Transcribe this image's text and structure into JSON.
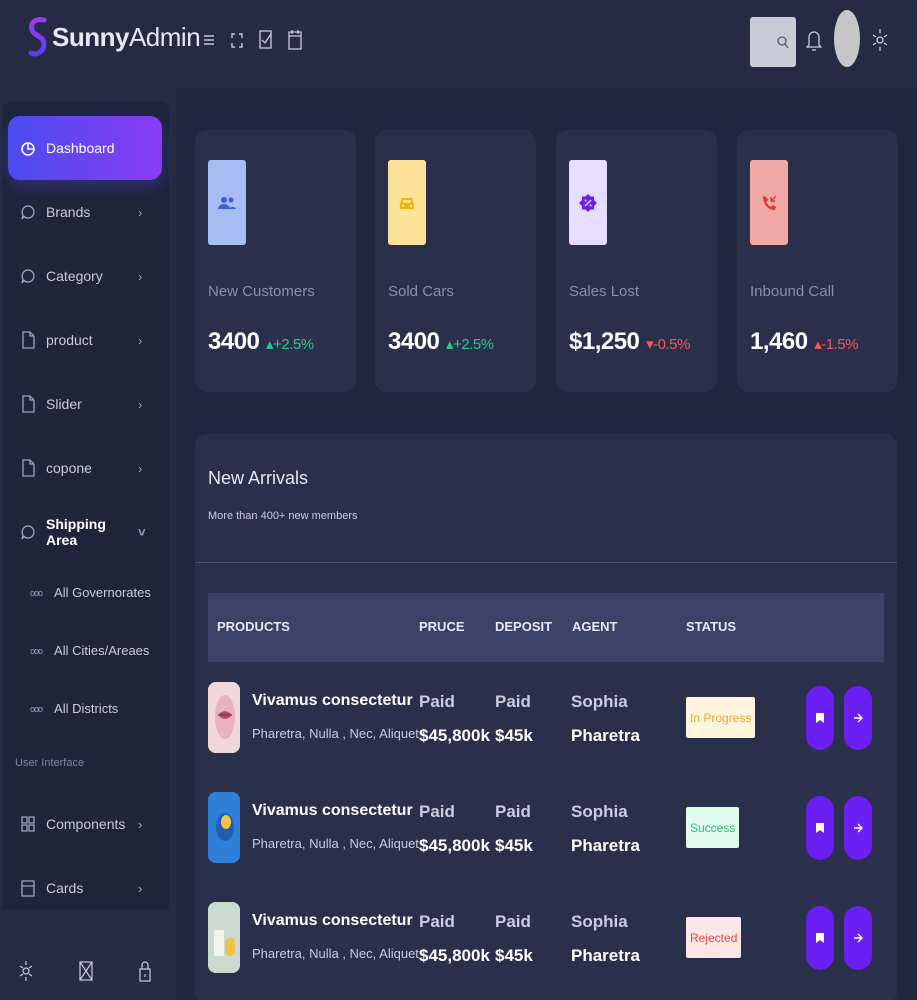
{
  "app": {
    "brand_bold": "Sunny",
    "brand_rest": "Admin"
  },
  "colors": {
    "accent": "#6b1ff2",
    "bg": "#20263d",
    "card": "#2a304c",
    "up": "#2ec98a",
    "down": "#f25a5a"
  },
  "header": {
    "icons": [
      "menu-icon",
      "fullscreen-icon",
      "checklist-icon",
      "calendar-icon",
      "search-icon",
      "bell-icon",
      "avatar",
      "gear-icon"
    ]
  },
  "sidebar": {
    "items": [
      {
        "label": "Dashboard",
        "icon": "pie-chart-icon"
      },
      {
        "label": "Brands",
        "icon": "chat-icon"
      },
      {
        "label": "Category",
        "icon": "chat-icon"
      },
      {
        "label": "product",
        "icon": "file-icon"
      },
      {
        "label": "Slider",
        "icon": "file-icon"
      },
      {
        "label": "copone",
        "icon": "file-icon"
      },
      {
        "label": "Shipping Area",
        "icon": "chat-icon"
      }
    ],
    "sub_items": [
      "All Governorates",
      "All Cities/Areaes",
      "All Districts"
    ],
    "section_label": "User Interface",
    "ui_items": [
      {
        "label": "Components",
        "icon": "grid-icon"
      },
      {
        "label": "Cards",
        "icon": "card-icon"
      }
    ],
    "bottom_icons": [
      "gear-icon",
      "mail-icon",
      "lock-icon"
    ]
  },
  "stats": [
    {
      "label": "New Customers",
      "value": "3400",
      "delta": "+2.5%",
      "trend": "up",
      "tile_color": "#a9bdf5",
      "icon": "users-icon"
    },
    {
      "label": "Sold Cars",
      "value": "3400",
      "delta": "+2.5%",
      "trend": "up",
      "tile_color": "#fde39a",
      "icon": "car-icon"
    },
    {
      "label": "Sales Lost",
      "value": "$1,250",
      "delta": "-0.5%",
      "trend": "down",
      "tile_color": "#e6dcfd",
      "icon": "discount-badge-icon"
    },
    {
      "label": "Inbound Call",
      "value": "1,460",
      "delta": "-1.5%",
      "trend": "up-red",
      "tile_color": "#f1a9a6",
      "icon": "phone-incoming-icon"
    }
  ],
  "arrivals": {
    "title": "New Arrivals",
    "subtitle": "More than 400+ new members",
    "columns": [
      "PRODUCTS",
      "PRUCE",
      "DEPOSIT",
      "AGENT",
      "STATUS"
    ],
    "rows": [
      {
        "name": "Vivamus consectetur",
        "desc": "Pharetra, Nulla , Nec, Aliquet",
        "price_top": "Paid",
        "price": "$45,800k",
        "deposit_top": "Paid",
        "deposit": "$45k",
        "agent_first": "Sophia",
        "agent_last": "Pharetra",
        "status": "In Progress",
        "status_bg": "#fff4de",
        "status_fg": "#f0a52a",
        "thumb": "lips-product-image"
      },
      {
        "name": "Vivamus consectetur",
        "desc": "Pharetra, Nulla , Nec, Aliquet",
        "price_top": "Paid",
        "price": "$45,800k",
        "deposit_top": "Paid",
        "deposit": "$45k",
        "agent_first": "Sophia",
        "agent_last": "Pharetra",
        "status": "Success",
        "status_bg": "#e2fbef",
        "status_fg": "#2ebc7b",
        "thumb": "blue-product-image"
      },
      {
        "name": "Vivamus consectetur",
        "desc": "Pharetra, Nulla , Nec, Aliquet",
        "price_top": "Paid",
        "price": "$45,800k",
        "deposit_top": "Paid",
        "deposit": "$45k",
        "agent_first": "Sophia",
        "agent_last": "Pharetra",
        "status": "Rejected",
        "status_bg": "#fde6e6",
        "status_fg": "#e54848",
        "thumb": "cosmetics-product-image"
      }
    ]
  }
}
